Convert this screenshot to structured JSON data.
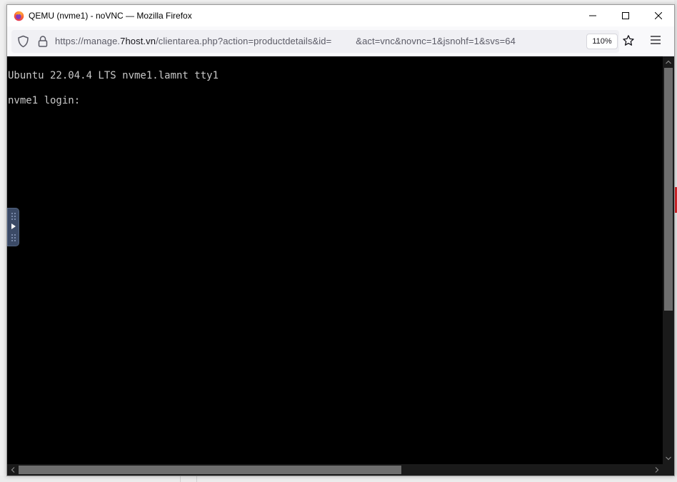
{
  "window": {
    "title": "QEMU (nvme1) - noVNC — Mozilla Firefox"
  },
  "navbar": {
    "url_prefix": "https://manage.",
    "url_domain": "7host.vn",
    "url_rest": "/clientarea.php?action=productdetails&id=",
    "url_tail": "&act=vnc&novnc=1&jsnohf=1&svs=64",
    "zoom": "110%"
  },
  "terminal": {
    "lines": [
      "Ubuntu 22.04.4 LTS nvme1.lamnt tty1",
      "nvme1 login:"
    ]
  },
  "icons": {
    "browser": "firefox-logo-icon",
    "minimize": "minimize-icon",
    "maximize": "maximize-icon",
    "close": "close-icon",
    "tracking": "shield-icon",
    "security": "lock-icon",
    "bookmark": "star-icon",
    "menu": "hamburger-menu-icon"
  },
  "colors": {
    "terminal_bg": "#000000",
    "terminal_fg": "#c8c8c8",
    "novnc_handle": "#3b4a66"
  }
}
